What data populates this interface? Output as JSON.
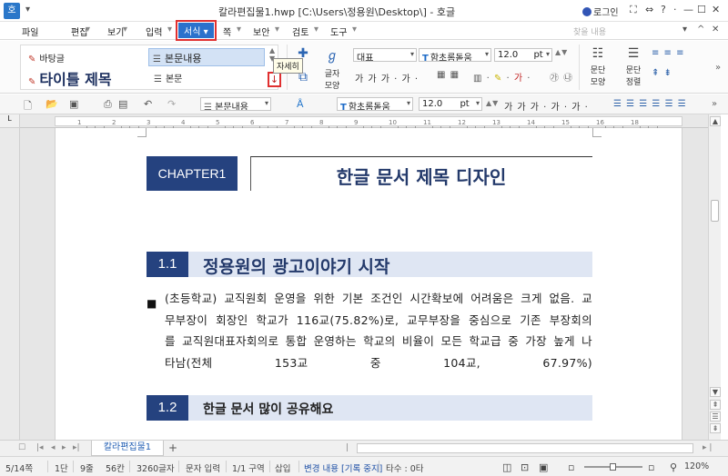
{
  "window": {
    "title": "칼라편집물1.hwp [C:\\Users\\정용원\\Desktop\\] - 호글",
    "app_logo": "호",
    "login_label": "로그인",
    "quick_icons": [
      "save-icon",
      "undo-icon",
      "redo-icon"
    ]
  },
  "menu": {
    "items": [
      {
        "label": "파일"
      },
      {
        "label": "편집"
      },
      {
        "label": "보기"
      },
      {
        "label": "입력"
      },
      {
        "label": "서식"
      },
      {
        "label": "쪽"
      },
      {
        "label": "보안"
      },
      {
        "label": "검토"
      },
      {
        "label": "도구"
      }
    ],
    "active": "서식",
    "search_placeholder": "찾을 내용"
  },
  "ribbon": {
    "styles": {
      "body": "바탕글",
      "title": "타이틀 제목",
      "content": "본문내용",
      "text": "본문"
    },
    "detail_tooltip": "자세히",
    "char_shape_label_1": "글자",
    "char_shape_label_2": "모양",
    "style_field": "대표",
    "font_field": "함초롬돋움",
    "size_field": "12.0",
    "size_unit": "pt",
    "para_shape_label_1": "문단",
    "para_shape_label_2": "모양",
    "para_align_label_1": "문단",
    "para_align_label_2": "정렬",
    "char_buttons": "가  가  가  ·  가  ·",
    "accent_color": "#2b71cc"
  },
  "format_bar": {
    "style": "본문내용",
    "font": "함초롬돋움",
    "size": "12.0",
    "unit": "pt",
    "char_buttons": "가  가  가  ·  가  ·  가  ·"
  },
  "ruler": {
    "numbers": [
      "1",
      "2",
      "3",
      "4",
      "5",
      "6",
      "7",
      "8",
      "9",
      "10",
      "11",
      "12",
      "13",
      "14",
      "15",
      "16",
      "18"
    ]
  },
  "document": {
    "chapter_label": "CHAPTER1",
    "chapter_title": "한글 문서 제목 디자인",
    "sections": [
      {
        "num": "1.1",
        "title": "정용원의 광고이야기 시작"
      },
      {
        "num": "1.2",
        "title": "한글 문서 많이 공유해요"
      }
    ],
    "bullet": "■",
    "paragraph": "(초등학교) 교직원회 운영을 위한 기본 조건인 시간확보에 어려움은 크게 없음. 교무부장이 회장인 학교가 116교(75.82%)로, 교무부장을 중심으로 기존 부장회의를 교직원대표자회의로 통합 운영하는 학교의 비율이 모든 학교급 중 가장 높게 나타남(전체 153교 중 104교, 67.97%)",
    "brand_color": "#25427f",
    "section_bg": "#dfe6f3"
  },
  "tabs": {
    "doc_tab": "칼라편집물1",
    "add_label": "+"
  },
  "status": {
    "page": "5/14쪽",
    "column": "1단",
    "line": "9줄",
    "col": "56칸",
    "chars": "3260글자",
    "input_mode": "문자 입력",
    "section": "1/1 구역",
    "insert": "삽입",
    "track": "변경 내용 [기록 중지]",
    "typing": "타수 : 0타",
    "zoom": "120%",
    "zoom_fraction": 0.5
  }
}
